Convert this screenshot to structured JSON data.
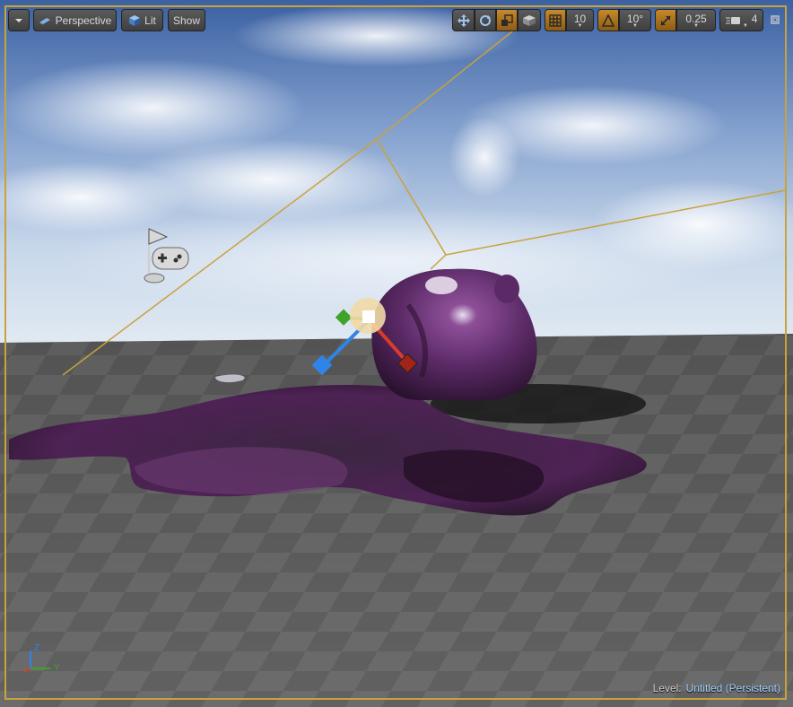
{
  "toolbar": {
    "view_mode_label": "Perspective",
    "lighting_label": "Lit",
    "show_label": "Show",
    "grid_snap_value": "10",
    "rotation_snap_value": "10°",
    "scale_snap_value": "0.25",
    "camera_speed_value": "4"
  },
  "status": {
    "level_prefix": "Level:",
    "level_name": "Untitled (Persistent)"
  },
  "axis_indicator": {
    "z": "Z",
    "y": "Y"
  },
  "colors": {
    "selection_frame": "#c9a23a",
    "active_tool": "#b57a21",
    "x_axis": "#d83b2a",
    "y_axis": "#3fa32a",
    "z_axis": "#2f84e8",
    "level_name": "#9fd1ff"
  },
  "icons": {
    "viewport_menu": "chevron-down-icon",
    "perspective": "camera-icon",
    "lit": "cube-icon",
    "translate": "move-arrows-icon",
    "rotate": "rotate-icon",
    "scale": "scale-icon",
    "coordinate_space": "world-icon",
    "grid_snap": "grid-icon",
    "rotation_snap": "angle-icon",
    "scale_snap": "scale-arrow-icon",
    "camera_speed": "camera-speed-icon",
    "maximize": "maximize-icon"
  }
}
